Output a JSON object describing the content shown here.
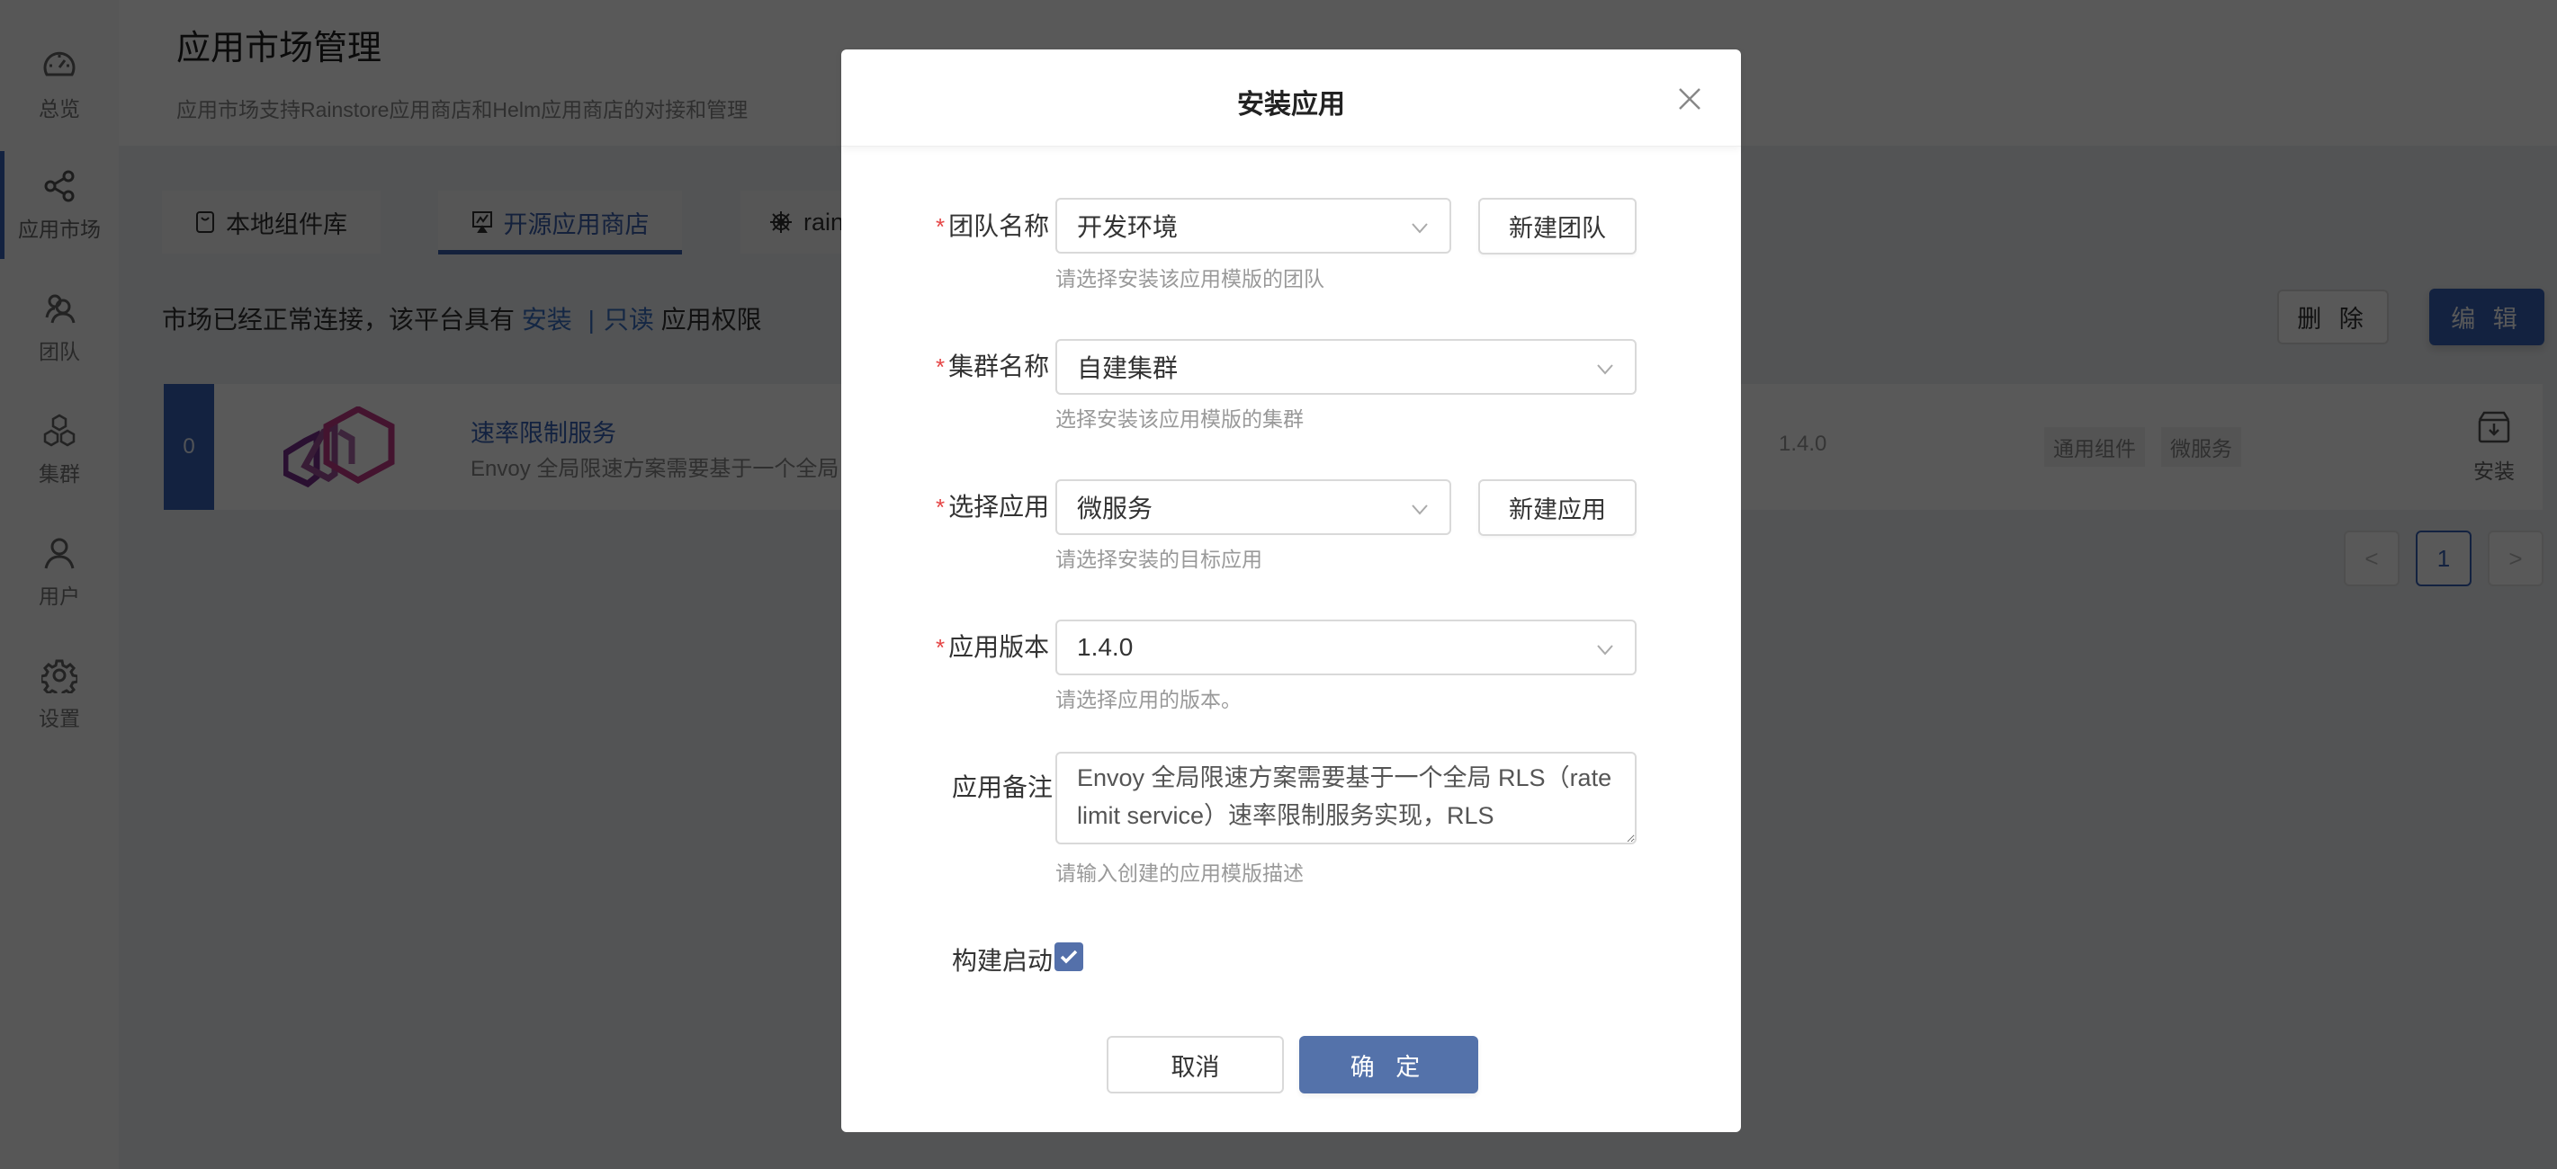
{
  "sidebar": {
    "items": [
      {
        "label": "总览",
        "icon": "dashboard-icon"
      },
      {
        "label": "应用市场",
        "icon": "share-icon",
        "active": true
      },
      {
        "label": "团队",
        "icon": "team-icon"
      },
      {
        "label": "集群",
        "icon": "cluster-icon"
      },
      {
        "label": "用户",
        "icon": "user-icon"
      },
      {
        "label": "设置",
        "icon": "gear-icon"
      }
    ]
  },
  "header": {
    "title": "应用市场管理",
    "subtitle": "应用市场支持Rainstore应用商店和Helm应用商店的对接和管理"
  },
  "tabs": [
    {
      "label": "本地组件库",
      "icon": "local-library-icon"
    },
    {
      "label": "开源应用商店",
      "icon": "store-icon",
      "active": true
    },
    {
      "label": "rain",
      "icon": "helm-icon"
    }
  ],
  "permission": {
    "prefix": "市场已经正常连接，该平台具有",
    "install": "安装",
    "separator": "|",
    "readonly": "只读",
    "suffix": "应用权限"
  },
  "actions": {
    "delete": "删 除",
    "edit": "编 辑"
  },
  "app_card": {
    "index": "0",
    "title": "速率限制服务",
    "description": "Envoy 全局限速方案需要基于一个全局 RLS（rate limit service）速率限制服务实现，RLS",
    "version": "1.4.0",
    "tags": [
      "通用组件",
      "微服务"
    ],
    "install_label": "安装"
  },
  "pagination": {
    "prev": "<",
    "current": "1",
    "next": ">"
  },
  "modal": {
    "title": "安装应用",
    "fields": {
      "team": {
        "label": "团队名称",
        "value": "开发环境",
        "hint": "请选择安装该应用模版的团队",
        "button": "新建团队"
      },
      "cluster": {
        "label": "集群名称",
        "value": "自建集群",
        "hint": "选择安装该应用模版的集群"
      },
      "app": {
        "label": "选择应用",
        "value": "微服务",
        "hint": "请选择安装的目标应用",
        "button": "新建应用"
      },
      "version": {
        "label": "应用版本",
        "value": "1.4.0",
        "hint": "请选择应用的版本。"
      },
      "note": {
        "label": "应用备注",
        "value": "Envoy 全局限速方案需要基于一个全局 RLS（rate limit service）速率限制服务实现，RLS",
        "hint": "请输入创建的应用模版描述"
      },
      "build_start": {
        "label": "构建启动",
        "checked": true
      }
    },
    "required_mark": "*",
    "cancel": "取消",
    "confirm": "确 定"
  },
  "colors": {
    "primary": "#3763b7",
    "modal_primary": "#5472aa",
    "required": "#e54545"
  }
}
